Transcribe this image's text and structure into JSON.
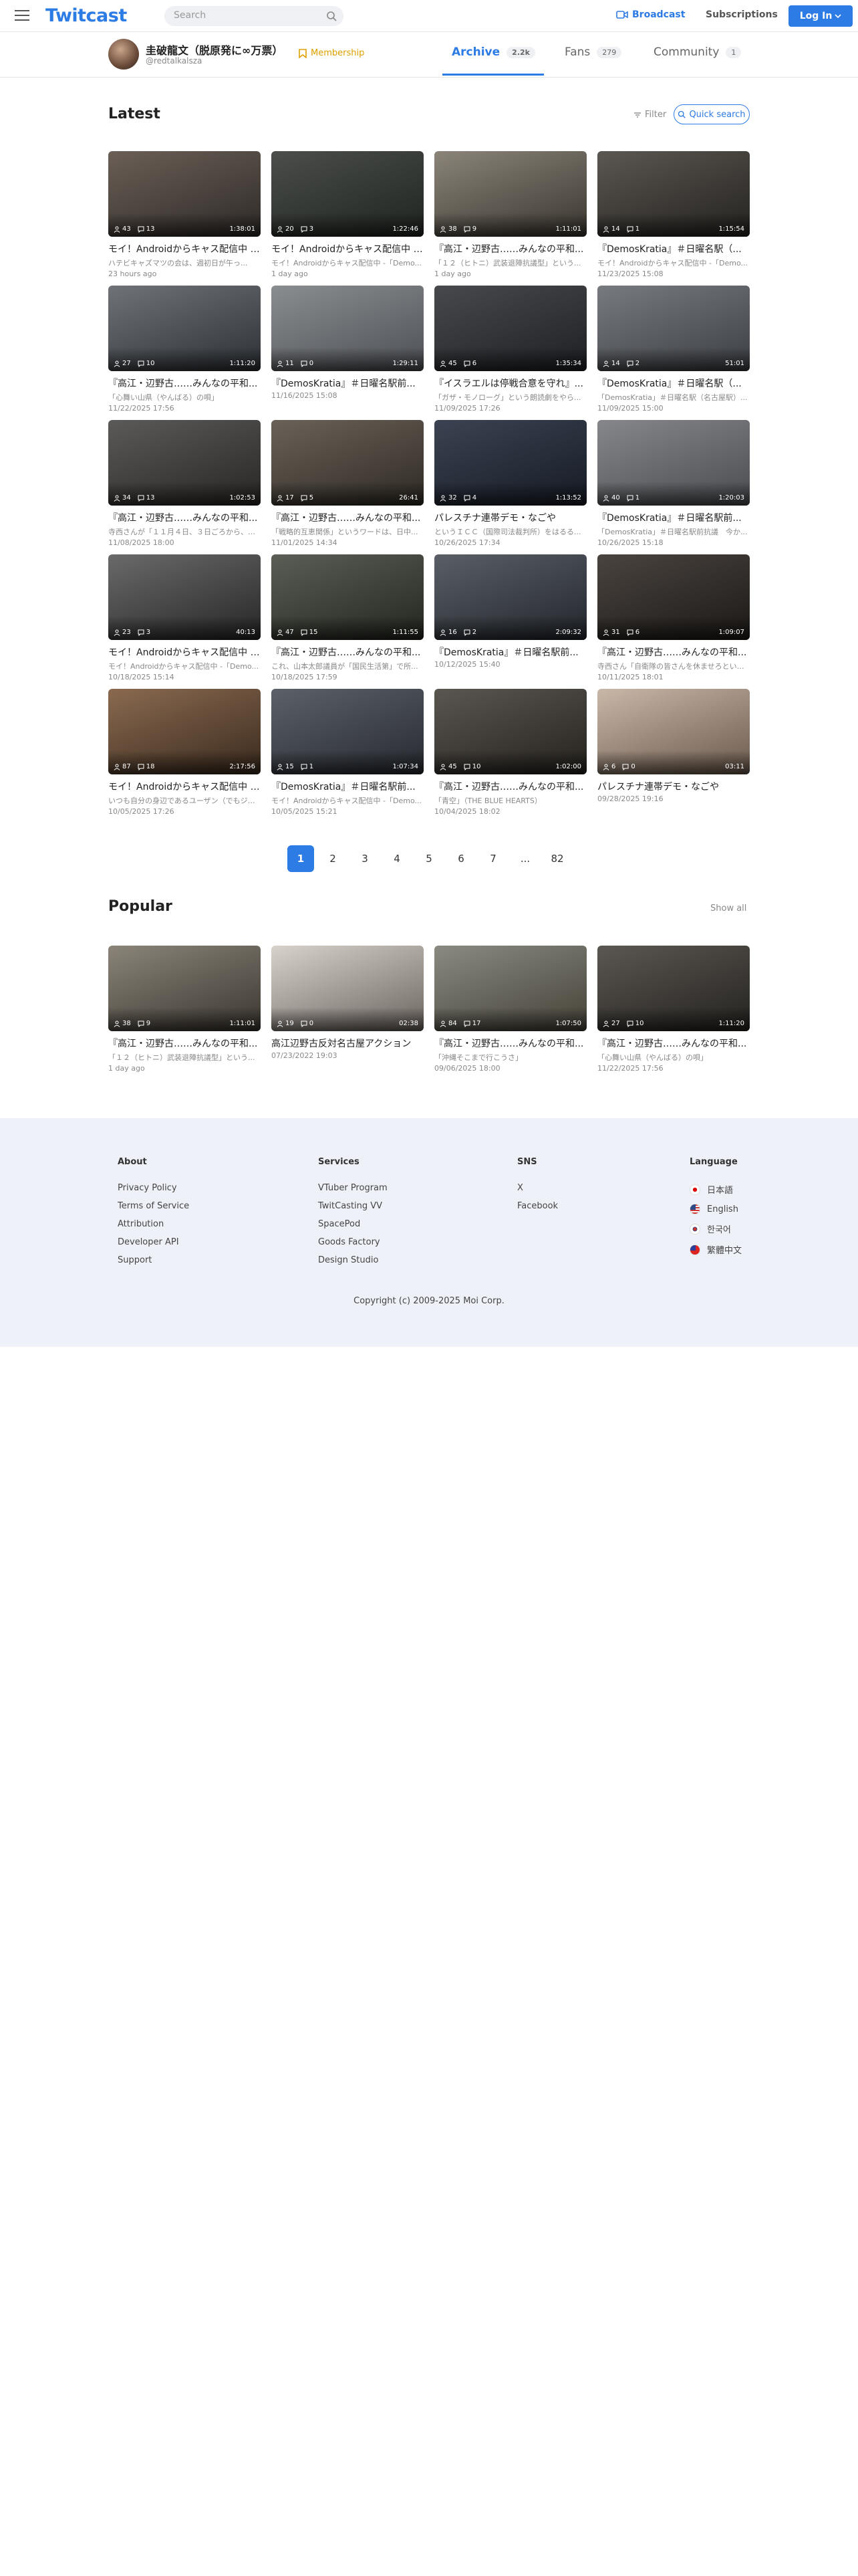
{
  "header": {
    "logo": "Twitcast",
    "search_placeholder": "Search",
    "broadcast_label": "Broadcast",
    "subscriptions_label": "Subscriptions",
    "login_label": "Log In"
  },
  "profile": {
    "name": "圭破龍文（脱原発に∞万票）",
    "id": "@redtalkalsza",
    "membership_label": "Membership",
    "tabs": [
      {
        "label": "Archive",
        "count": "2.2k"
      },
      {
        "label": "Fans",
        "count": "279"
      },
      {
        "label": "Community",
        "count": "1"
      }
    ]
  },
  "latest": {
    "title": "Latest",
    "filter_label": "Filter",
    "quick_search_label": "Quick search",
    "videos": [
      {
        "title": "モイ！Androidからキャス配信中 -...",
        "sub": "ハテビキャズマツの会は、週初日が午っ...",
        "date": "23 hours ago",
        "views": "43",
        "comments": "13",
        "duration": "1:38:01"
      },
      {
        "title": "モイ！Androidからキャス配信中 -...",
        "sub": "モイ！Androidからキャス配信中 -「Demo...",
        "date": "1 day ago",
        "views": "20",
        "comments": "3",
        "duration": "1:22:46"
      },
      {
        "title": "『高江・辺野古……みんなの平和...",
        "sub": "「１２（ヒトニ）武装退陣抗議型」という...",
        "date": "1 day ago",
        "views": "38",
        "comments": "9",
        "duration": "1:11:01"
      },
      {
        "title": "『DemosKratia』＃日曜名駅（...",
        "sub": "モイ！Androidからキャス配信中 -「Demo...",
        "date": "11/23/2025 15:08",
        "views": "14",
        "comments": "1",
        "duration": "1:15:54"
      },
      {
        "title": "『高江・辺野古……みんなの平和...",
        "sub": "「心舞い山県（やんばる）の唄」",
        "date": "11/22/2025 17:56",
        "views": "27",
        "comments": "10",
        "duration": "1:11:20"
      },
      {
        "title": "『DemosKratia』＃日曜名駅前...",
        "sub": "",
        "date": "11/16/2025 15:08",
        "views": "11",
        "comments": "0",
        "duration": "1:29:11"
      },
      {
        "title": "『イスラエルは停戦合意を守れ』...",
        "sub": "「ガザ・モノローグ」という朗読劇をやら...",
        "date": "11/09/2025 17:26",
        "views": "45",
        "comments": "6",
        "duration": "1:35:34"
      },
      {
        "title": "『DemosKratia』＃日曜名駅（...",
        "sub": "「DemosKratia」＃日曜名駅（名古屋駅）...",
        "date": "11/09/2025 15:00",
        "views": "14",
        "comments": "2",
        "duration": "51:01"
      },
      {
        "title": "『高江・辺野古……みんなの平和...",
        "sub": "寺西さんが「１１月４日、３日ごろから、至...",
        "date": "11/08/2025 18:00",
        "views": "34",
        "comments": "13",
        "duration": "1:02:53"
      },
      {
        "title": "『高江・辺野古……みんなの平和...",
        "sub": "「戦略的互恵関係」というワードは、日中...",
        "date": "11/01/2025 14:34",
        "views": "17",
        "comments": "5",
        "duration": "26:41"
      },
      {
        "title": "パレスチナ連帯デモ・なごや",
        "sub": "というＩＣＣ（国際司法裁判所）をはるる...",
        "date": "10/26/2025 17:34",
        "views": "32",
        "comments": "4",
        "duration": "1:13:52"
      },
      {
        "title": "『DemosKratia』＃日曜名駅前...",
        "sub": "「DemosKratia」＃日曜名駅前抗議　今か...",
        "date": "10/26/2025 15:18",
        "views": "40",
        "comments": "1",
        "duration": "1:20:03"
      },
      {
        "title": "モイ！Androidからキャス配信中 -...",
        "sub": "モイ！Androidからキャス配信中 -「Demo...",
        "date": "10/18/2025 15:14",
        "views": "23",
        "comments": "3",
        "duration": "40:13"
      },
      {
        "title": "『高江・辺野古……みんなの平和...",
        "sub": "これ、山本太郎議員が「国民生活第」で所...",
        "date": "10/18/2025 17:59",
        "views": "47",
        "comments": "15",
        "duration": "1:11:55"
      },
      {
        "title": "『DemosKratia』＃日曜名駅前...",
        "sub": "",
        "date": "10/12/2025 15:40",
        "views": "16",
        "comments": "2",
        "duration": "2:09:32"
      },
      {
        "title": "『高江・辺野古……みんなの平和...",
        "sub": "寺西さん「自衛隊の皆さんを休ませろという...",
        "date": "10/11/2025 18:01",
        "views": "31",
        "comments": "6",
        "duration": "1:09:07"
      },
      {
        "title": "モイ！Androidからキャス配信中 -...",
        "sub": "いつも自分の身辺であるユーザン（でもジェ...",
        "date": "10/05/2025 17:26",
        "views": "87",
        "comments": "18",
        "duration": "2:17:56"
      },
      {
        "title": "『DemosKratia』＃日曜名駅前...",
        "sub": "モイ！Androidからキャス配信中 -「Demo...",
        "date": "10/05/2025 15:21",
        "views": "15",
        "comments": "1",
        "duration": "1:07:34"
      },
      {
        "title": "『高江・辺野古……みんなの平和...",
        "sub": "「青空」（THE BLUE HEARTS）",
        "date": "10/04/2025 18:02",
        "views": "45",
        "comments": "10",
        "duration": "1:02:00"
      },
      {
        "title": "パレスチナ連帯デモ・なごや",
        "sub": "",
        "date": "09/28/2025 19:16",
        "views": "6",
        "comments": "0",
        "duration": "03:11"
      }
    ]
  },
  "pagination": {
    "pages": [
      "1",
      "2",
      "3",
      "4",
      "5",
      "6",
      "7",
      "...",
      "82"
    ],
    "current": "1"
  },
  "popular": {
    "title": "Popular",
    "show_all_label": "Show all",
    "videos": [
      {
        "title": "『高江・辺野古……みんなの平和...",
        "sub": "「１２（ヒトニ）武装退陣抗議型」という...",
        "date": "1 day ago",
        "views": "38",
        "comments": "9",
        "duration": "1:11:01"
      },
      {
        "title": "高江辺野古反対名古屋アクション",
        "sub": "",
        "date": "07/23/2022 19:03",
        "views": "19",
        "comments": "0",
        "duration": "02:38"
      },
      {
        "title": "『高江・辺野古……みんなの平和...",
        "sub": "「沖縄そこまで行こうさ」",
        "date": "09/06/2025 18:00",
        "views": "84",
        "comments": "17",
        "duration": "1:07:50"
      },
      {
        "title": "『高江・辺野古……みんなの平和...",
        "sub": "「心舞い山県（やんばる）の唄」",
        "date": "11/22/2025 17:56",
        "views": "27",
        "comments": "10",
        "duration": "1:11:20"
      }
    ]
  },
  "footer": {
    "about": {
      "heading": "About",
      "links": [
        "Privacy Policy",
        "Terms of Service",
        "Attribution",
        "Developer API",
        "Support"
      ]
    },
    "services": {
      "heading": "Services",
      "links": [
        "VTuber Program",
        "TwitCasting VV",
        "SpacePod",
        "Goods Factory",
        "Design Studio"
      ]
    },
    "sns": {
      "heading": "SNS",
      "links": [
        "X",
        "Facebook"
      ]
    },
    "language": {
      "heading": "Language",
      "links": [
        "日本語",
        "English",
        "한국어",
        "繁體中文"
      ]
    },
    "copyright": "Copyright (c) 2009-2025 Moi Corp."
  }
}
